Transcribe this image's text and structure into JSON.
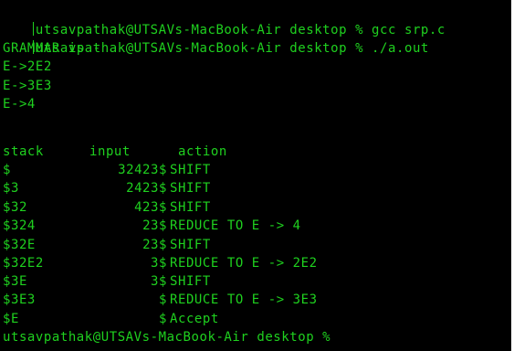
{
  "terminal": {
    "top_partial": "~ ~ ~   ~ ~ ~ ~ ~ ~ ~ ~ ~ ~ ~ ~",
    "commands": [
      "utsavpathak@UTSAVs-MacBook-Air desktop % gcc srp.c",
      "utsavpathak@UTSAVs-MacBook-Air desktop % ./a.out"
    ],
    "grammar_title": "GRAMMAR is -",
    "grammar_rules": [
      "E->2E2",
      "E->3E3",
      "E->4"
    ],
    "table_headers": {
      "stack": "stack",
      "input": "input",
      "action": "action"
    },
    "rows": [
      {
        "stack": "$",
        "input": "32423$",
        "action": "SHIFT"
      },
      {
        "stack": "$3",
        "input": "2423$",
        "action": "SHIFT"
      },
      {
        "stack": "$32",
        "input": "423$",
        "action": "SHIFT"
      },
      {
        "stack": "$324",
        "input": "23$",
        "action": "REDUCE TO E -> 4"
      },
      {
        "stack": "$32E",
        "input": "23$",
        "action": "SHIFT"
      },
      {
        "stack": "$32E2",
        "input": "3$",
        "action": "REDUCE TO E -> 2E2"
      },
      {
        "stack": "$3E",
        "input": "3$",
        "action": "SHIFT"
      },
      {
        "stack": "$3E3",
        "input": "$",
        "action": "REDUCE TO E -> 3E3"
      },
      {
        "stack": "$E",
        "input": "$",
        "action": "Accept"
      }
    ],
    "final_prompt": "utsavpathak@UTSAVs-MacBook-Air desktop %",
    "colors": {
      "background": "#000000",
      "text": "#1fd11f"
    }
  }
}
